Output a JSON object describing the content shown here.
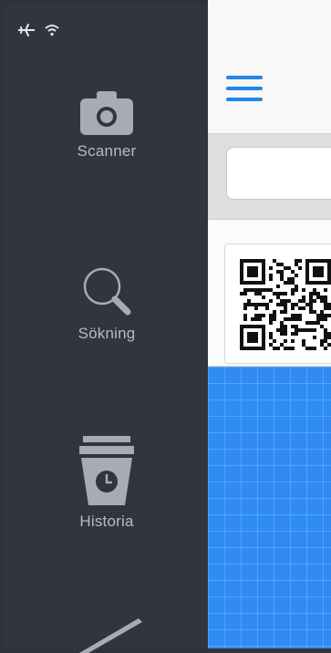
{
  "sidebar": {
    "items": [
      {
        "label": "Scanner",
        "icon": "camera-icon"
      },
      {
        "label": "Sökning",
        "icon": "magnifier-icon"
      },
      {
        "label": "Historia",
        "icon": "history-stack-icon"
      },
      {
        "label": "",
        "icon": "pen-icon"
      }
    ]
  },
  "status_bar": {
    "icons": [
      "airplane-icon",
      "wifi-icon"
    ]
  },
  "search": {
    "value": "",
    "placeholder": ""
  },
  "colors": {
    "sidebar_bg": "#32343f",
    "sidebar_text": "#b8bbc4",
    "accent_blue": "#1f86f0",
    "grid_blue": "#2f8cf0"
  }
}
